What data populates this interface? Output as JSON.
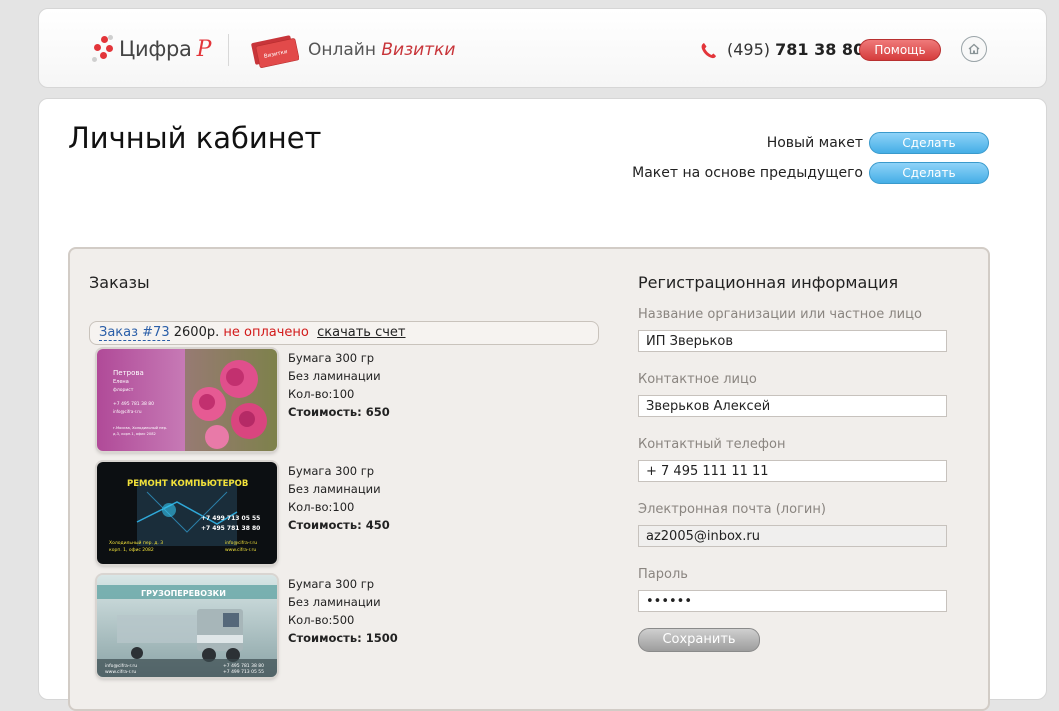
{
  "header": {
    "logo_text": "Цифра",
    "logo_letter": "Р",
    "card_icon_text": "Визитки",
    "online_prefix": "Онлайн",
    "online_accent": "Визитки",
    "phone_code": "(495)",
    "phone_number": "781 38 80",
    "help_label": "Помощь",
    "colors": {
      "accent_red": "#e3353a",
      "button_red": "#d53c3c"
    },
    "icons": {
      "phone": "phone-icon",
      "home": "home-icon"
    }
  },
  "main": {
    "title": "Личный кабинет",
    "actions": [
      {
        "label": "Новый макет",
        "button": "Сделать"
      },
      {
        "label": "Макет на основе предыдущего",
        "button": "Сделать"
      }
    ],
    "colors": {
      "action_blue": "#45aee6"
    }
  },
  "orders": {
    "title": "Заказы",
    "order": {
      "number_label": "Заказ #73",
      "price": "2600р.",
      "status": "не оплачено",
      "download_label": "скачать счет"
    },
    "items": [
      {
        "paper": "Бумага 300 гр",
        "lamination": "Без ламинации",
        "qty": "Кол-во:100",
        "cost_label": "Стоимость:",
        "cost_value": "650",
        "card": {
          "name": "Петрова",
          "sub": "Елена",
          "role": "флорист",
          "phone": "+7 495 781 38 80",
          "email": "info@cifra-r.ru",
          "addr1": "г.Москва, Холодильный пер.",
          "addr2": "д.3, корп.1, офис 2082"
        }
      },
      {
        "paper": "Бумага 300 гр",
        "lamination": "Без ламинации",
        "qty": "Кол-во:100",
        "cost_label": "Стоимость:",
        "cost_value": "450",
        "card": {
          "title": "РЕМОНТ КОМПЬЮТЕРОВ",
          "phone1": "+7 499 713 05 55",
          "phone2": "+7 495 781 38 80",
          "addr1": "Холодильный пер. д. 3",
          "addr2": "корп. 1, офис 2082",
          "email": "info@cifra-r.ru",
          "site": "www.cifra-r.ru"
        }
      },
      {
        "paper": "Бумага 300 гр",
        "lamination": "Без ламинации",
        "qty": "Кол-во:500",
        "cost_label": "Стоимость:",
        "cost_value": "1500",
        "card": {
          "title": "ГРУЗОПЕРЕВОЗКИ",
          "email": "info@cifra-r.ru",
          "site": "www.cifra-r.ru",
          "phone1": "+7 495 781 38 80",
          "phone2": "+7 499 713 05 55"
        }
      }
    ]
  },
  "registration": {
    "title": "Регистрационная информация",
    "fields": [
      {
        "label": "Название организации или частное лицо",
        "value": "ИП Зверьков"
      },
      {
        "label": "Контактное лицо",
        "value": "Зверьков Алексей"
      },
      {
        "label": "Контактный телефон",
        "value": "+ 7 495 111 11 11"
      },
      {
        "label": "Электронная почта (логин)",
        "value": "az2005@inbox.ru"
      },
      {
        "label": "Пароль",
        "value": "••••••"
      }
    ],
    "save_label": "Сохранить"
  }
}
